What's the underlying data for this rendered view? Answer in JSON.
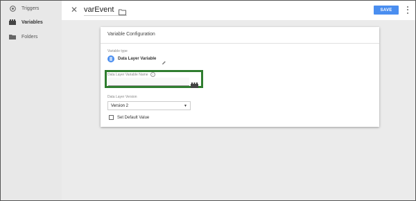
{
  "sidebar": {
    "items": [
      {
        "label": "Triggers",
        "icon": "trigger-icon"
      },
      {
        "label": "Variables",
        "icon": "variables-icon",
        "active": true
      },
      {
        "label": "Folders",
        "icon": "folder-icon"
      }
    ]
  },
  "header": {
    "title": "varEvent",
    "save_label": "SAVE"
  },
  "card": {
    "title": "Variable Configuration",
    "variable_type_label": "Variable type",
    "variable_type_value": "Data Layer Variable",
    "dlv_name_label": "Data Layer Variable Name",
    "dlv_name_value": "",
    "dlv_version_label": "Data Layer Version",
    "dlv_version_value": "Version 2",
    "default_value_label": "Set Default Value"
  },
  "colors": {
    "accent": "#4a8ef0",
    "highlight": "#2f7d2f"
  }
}
